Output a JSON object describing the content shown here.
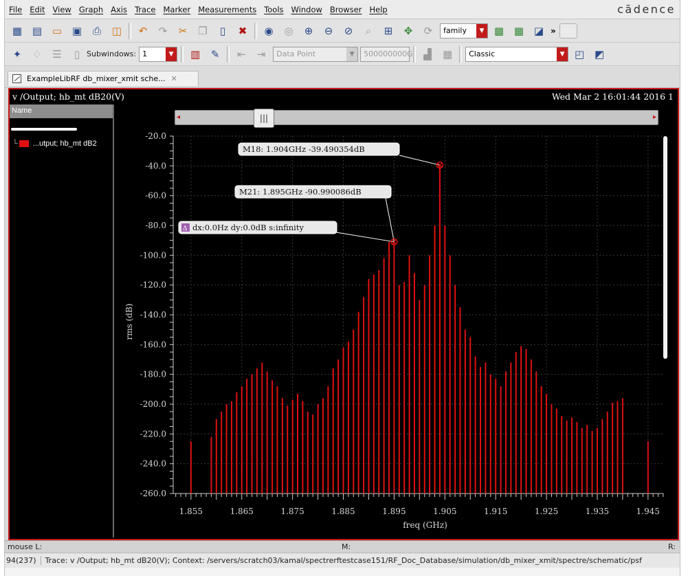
{
  "menubar": {
    "items": [
      "File",
      "Edit",
      "View",
      "Graph",
      "Axis",
      "Trace",
      "Marker",
      "Measurements",
      "Tools",
      "Window",
      "Browser",
      "Help"
    ],
    "brand": "cādence"
  },
  "toolbar": {
    "family_combo": "family",
    "subwindows_label": "Subwindows:",
    "subwindows_value": "1",
    "data_point": "Data Point",
    "frequency": "500000000G",
    "layout_combo": "Classic"
  },
  "tab": {
    "title": "ExampleLibRF db_mixer_xmit sche...",
    "close": "✕"
  },
  "graph": {
    "title": "v /Output; hb_mt dB20(V)",
    "timestamp": "Wed Mar 2 16:01:44 2016  1",
    "legend_header": "Name",
    "legend_trace": "...utput; hb_mt dB2",
    "trace_color": "#e01010",
    "marker_m18": "M18: 1.904GHz -39.490354dB",
    "marker_m21": "M21: 1.895GHz -90.990086dB",
    "delta_marker": "dx:0.0Hz dy:0.0dB s:infinity",
    "delta_icon": "Δ"
  },
  "chart_data": {
    "type": "bar",
    "xlabel": "freq (GHz)",
    "ylabel": "rms (dB)",
    "xlim": [
      1.8515,
      1.948
    ],
    "ylim": [
      -260,
      -20
    ],
    "xticks": [
      "1.855",
      "1.865",
      "1.875",
      "1.885",
      "1.895",
      "1.905",
      "1.915",
      "1.925",
      "1.935",
      "1.945"
    ],
    "yticks": [
      "-20.0",
      "-40.0",
      "-60.0",
      "-80.0",
      "-100.0",
      "-120.0",
      "-140.0",
      "-160.0",
      "-180.0",
      "-200.0",
      "-220.0",
      "-240.0",
      "-260.0"
    ],
    "baseline": -260,
    "series": [
      {
        "x": [
          1.855,
          1.859,
          1.86,
          1.861,
          1.862,
          1.863,
          1.864,
          1.865,
          1.866,
          1.867,
          1.868,
          1.869,
          1.87,
          1.871,
          1.872,
          1.873,
          1.874,
          1.875,
          1.876,
          1.877,
          1.878,
          1.879,
          1.88,
          1.881,
          1.882,
          1.883,
          1.884,
          1.885,
          1.886,
          1.887,
          1.888,
          1.889,
          1.89,
          1.891,
          1.892,
          1.893,
          1.894,
          1.895,
          1.896,
          1.897,
          1.898,
          1.899,
          1.9,
          1.901,
          1.902,
          1.903,
          1.904,
          1.905,
          1.906,
          1.907,
          1.908,
          1.909,
          1.91,
          1.911,
          1.912,
          1.913,
          1.914,
          1.915,
          1.916,
          1.917,
          1.918,
          1.919,
          1.92,
          1.921,
          1.922,
          1.923,
          1.924,
          1.925,
          1.926,
          1.927,
          1.928,
          1.929,
          1.93,
          1.931,
          1.932,
          1.933,
          1.934,
          1.935,
          1.936,
          1.937,
          1.938,
          1.939,
          1.94,
          1.945
        ],
        "y": [
          -225,
          -222,
          -210,
          -205,
          -200,
          -198,
          -192,
          -188,
          -183,
          -180,
          -176,
          -172,
          -178,
          -184,
          -188,
          -196,
          -201,
          -197,
          -193,
          -198,
          -205,
          -207,
          -200,
          -196,
          -188,
          -176,
          -170,
          -162,
          -158,
          -150,
          -138,
          -128,
          -116,
          -113,
          -110,
          -102,
          -90.99,
          -90.99,
          -120,
          -118,
          -100,
          -112,
          -130,
          -120,
          -100,
          -80,
          -39.49,
          -80,
          -100,
          -120,
          -135,
          -150,
          -155,
          -168,
          -175,
          -172,
          -180,
          -183,
          -188,
          -178,
          -172,
          -165,
          -161,
          -163,
          -170,
          -178,
          -188,
          -193,
          -200,
          -203,
          -208,
          -211,
          -209,
          -212,
          -216,
          -214,
          -218,
          -216,
          -210,
          -205,
          -199,
          -198,
          -196,
          -225
        ]
      }
    ],
    "markers": [
      {
        "name": "M18",
        "x": 1.904,
        "y": -39.49
      },
      {
        "name": "M21",
        "x": 1.895,
        "y": -90.99
      }
    ]
  },
  "status": {
    "mouse_l": "mouse L:",
    "mouse_m": "M:",
    "mouse_r": "R:",
    "count": "94(237)",
    "message": "Trace: v /Output; hb_mt dB20(V); Context: /servers/scratch03/kamal/spectrerftestcase151/RF_Doc_Database/simulation/db_mixer_xmit/spectre/schematic/psf"
  }
}
